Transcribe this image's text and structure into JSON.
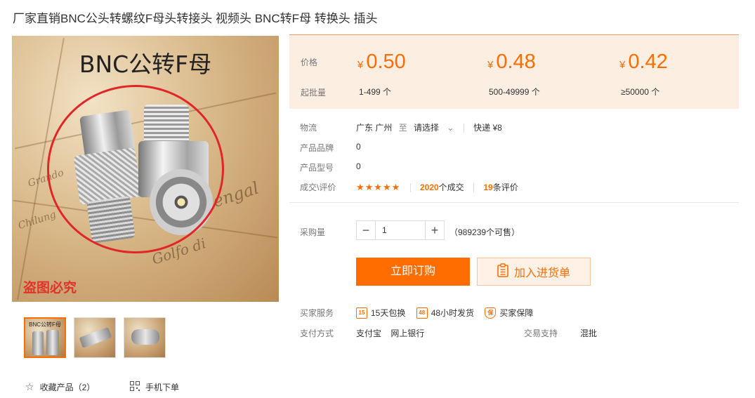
{
  "product": {
    "title": "厂家直销BNC公头转螺纹F母头转接头 视频头 BNC转F母 转换头 插头"
  },
  "gallery": {
    "overlay_title": "BNC公转F母",
    "watermark": "盗图必究",
    "map_words": [
      "Bengal",
      "Golfo di",
      "Chilung",
      "Grando"
    ],
    "thumbnails": [
      {
        "label": "BNC公转F母",
        "active": true
      },
      {
        "label": "",
        "active": false
      },
      {
        "label": "",
        "active": false
      }
    ]
  },
  "bottom_links": {
    "favorite": "收藏产品（2）",
    "mobile": "手机下单"
  },
  "pricing": {
    "price_label": "价格",
    "moq_label": "起批量",
    "currency": "¥",
    "tiers": [
      {
        "price": "0.50",
        "qty": "1-499 个"
      },
      {
        "price": "0.48",
        "qty": "500-49999 个"
      },
      {
        "price": "0.42",
        "qty": "≥50000 个"
      }
    ],
    "accent_color": "#ff6d00"
  },
  "details": {
    "logistics_label": "物流",
    "origin": "广东 广州",
    "to": "至",
    "destination": "请选择",
    "express": "快递 ¥8",
    "brand_label": "产品品牌",
    "brand_value": "0",
    "model_label": "产品型号",
    "model_value": "0",
    "deals_label": "成交\\评价",
    "stars": "★★★★★",
    "deal_count": "2020",
    "deal_suffix": "个成交",
    "review_count": "19",
    "review_suffix": "条评价"
  },
  "purchase": {
    "qty_label": "采购量",
    "qty_value": "1",
    "stock": "（989239个可售）",
    "buy_now": "立即订购",
    "add_to_cart": "加入进货单"
  },
  "services": {
    "label": "买家服务",
    "items": [
      {
        "icon": "15",
        "text": "15天包换"
      },
      {
        "icon": "48",
        "text": "48小时发货"
      },
      {
        "icon": "保",
        "text": "买家保障"
      }
    ]
  },
  "payment": {
    "label": "支付方式",
    "methods": [
      "支付宝",
      "网上银行"
    ],
    "trade_label": "交易支持",
    "trade_value": "混批"
  }
}
